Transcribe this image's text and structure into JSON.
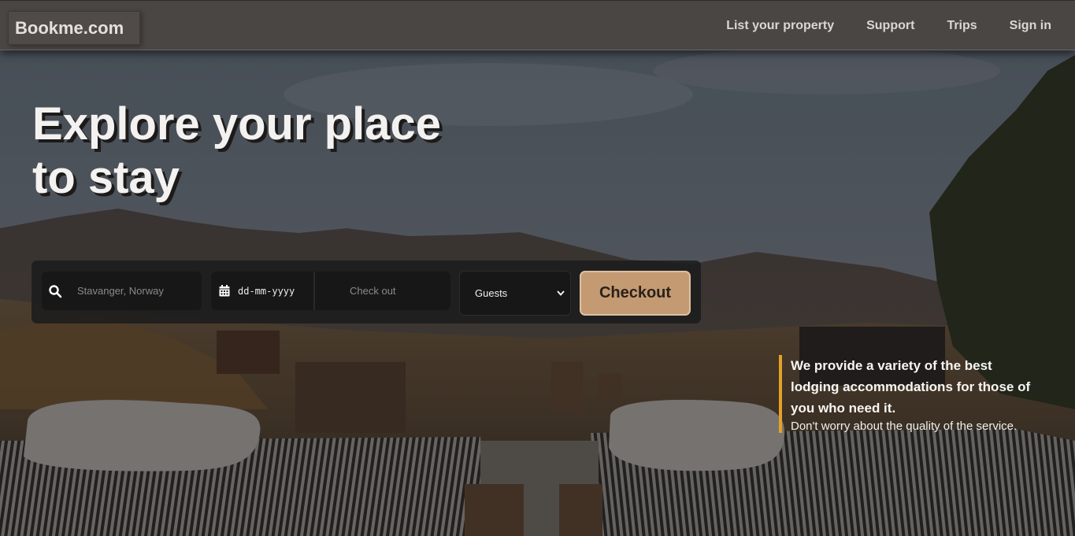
{
  "brand": {
    "name": "Bookme.com"
  },
  "nav": {
    "links": [
      "List your property",
      "Support",
      "Trips",
      "Sign in"
    ]
  },
  "hero": {
    "title_line1": "Explore your place",
    "title_line2": "to stay"
  },
  "search": {
    "location_placeholder": "Stavanger, Norway",
    "checkin_value": "dd-mm-yyyy",
    "checkout_placeholder": "Check out",
    "guests_selected": "Guests",
    "submit_label": "Checkout",
    "icons": [
      "search-icon",
      "calendar-icon",
      "chevron-down-icon"
    ]
  },
  "tagline": {
    "headline": "We provide a variety of the best lodging accommodations for those of you who need it.",
    "subtext": "Don't worry about the quality of the service."
  },
  "colors": {
    "navbar": "#4a4644",
    "accent_button": "#c49a72",
    "accent_bar": "#e4a12a",
    "panel": "#1c1c1c"
  }
}
